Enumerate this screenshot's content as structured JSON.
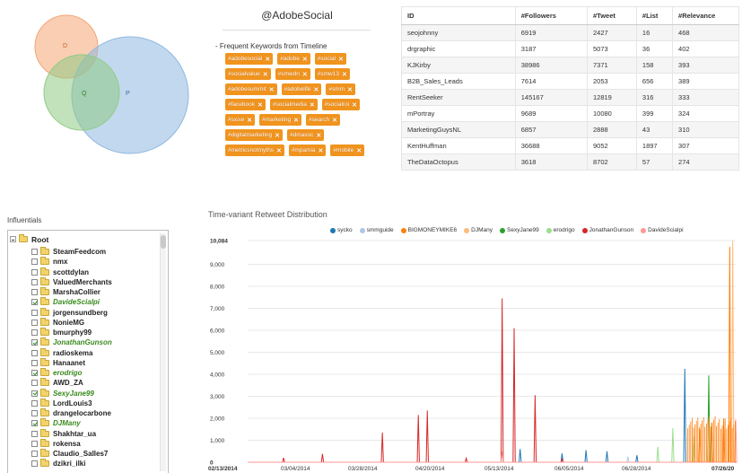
{
  "venn": {
    "sets": [
      {
        "label": "D",
        "color": "#f4a574"
      },
      {
        "label": "Q",
        "color": "#8fcb84"
      },
      {
        "label": "P",
        "color": "#8fb8e0"
      }
    ]
  },
  "account": {
    "title": "@AdobeSocial"
  },
  "keywords": {
    "heading": "- Frequent Keywords from Timeline",
    "remove_icon": "close-icon",
    "tag_color": "#f0941e",
    "items": [
      "#adobesocial",
      "#adobe",
      "#social",
      "#socialvalue",
      "#smwdn",
      "#smw13",
      "#adobesummit",
      "#adobelife",
      "#smm",
      "#facebook",
      "#socialmedia",
      "#socialroi",
      "#sxsw",
      "#marketing",
      "#search",
      "#digitalmarketing",
      "#dmasoc",
      "#metricsnotmyths",
      "#mpamia",
      "#mobile"
    ]
  },
  "table": {
    "headers": [
      "ID",
      "#Followers",
      "#Tweet",
      "#List",
      "#Relevance"
    ],
    "rows": [
      [
        "seojohnny",
        "6919",
        "2427",
        "16",
        "468"
      ],
      [
        "drgraphic",
        "3187",
        "5073",
        "36",
        "402"
      ],
      [
        "KJKirby",
        "38986",
        "7371",
        "158",
        "393"
      ],
      [
        "B2B_Sales_Leads",
        "7614",
        "2053",
        "656",
        "389"
      ],
      [
        "RentSeeker",
        "145167",
        "12819",
        "316",
        "333"
      ],
      [
        "mPortray",
        "9689",
        "10080",
        "399",
        "324"
      ],
      [
        "MarketingGuysNL",
        "6857",
        "2888",
        "43",
        "310"
      ],
      [
        "KentHuffman",
        "36688",
        "9052",
        "1897",
        "307"
      ],
      [
        "TheDataOctopus",
        "3618",
        "8702",
        "57",
        "274"
      ]
    ]
  },
  "influentials": {
    "label": "Influentials",
    "root": "Root",
    "items": [
      {
        "name": "SteamFeedcom",
        "checked": false
      },
      {
        "name": "nmx",
        "checked": false
      },
      {
        "name": "scottdylan",
        "checked": false
      },
      {
        "name": "ValuedMerchants",
        "checked": false
      },
      {
        "name": "MarshaCollier",
        "checked": false
      },
      {
        "name": "DavideScialpi",
        "checked": true
      },
      {
        "name": "jorgensundberg",
        "checked": false
      },
      {
        "name": "NonieMG",
        "checked": false
      },
      {
        "name": "bmurphy99",
        "checked": false
      },
      {
        "name": "JonathanGunson",
        "checked": true
      },
      {
        "name": "radioskema",
        "checked": false
      },
      {
        "name": "Hanaanet",
        "checked": false
      },
      {
        "name": "erodrigo",
        "checked": true
      },
      {
        "name": "AWD_ZA",
        "checked": false
      },
      {
        "name": "SexyJane99",
        "checked": true
      },
      {
        "name": "LordLouis3",
        "checked": false
      },
      {
        "name": "drangelocarbone",
        "checked": false
      },
      {
        "name": "DJMany",
        "checked": true
      },
      {
        "name": "Shakhtar_ua",
        "checked": false
      },
      {
        "name": "rokensa",
        "checked": false
      },
      {
        "name": "Claudio_Salles7",
        "checked": false
      },
      {
        "name": "dzikri_ilki",
        "checked": false
      }
    ]
  },
  "chart_title": "Time-variant Retweet Distribution",
  "chart_data": {
    "type": "line",
    "title": "Time-variant Retweet Distribution",
    "xlabel": "",
    "ylabel": "",
    "x_ticks": [
      "02/13/2014",
      "03/04/2014",
      "03/28/2014",
      "04/20/2014",
      "05/13/2014",
      "06/05/2014",
      "06/28/2014",
      "07/26/20"
    ],
    "x_range": [
      "2014-02-13",
      "2014-07-26"
    ],
    "ylim": [
      0,
      10084
    ],
    "y_ticks": [
      0,
      1000,
      2000,
      3000,
      4000,
      5000,
      6000,
      7000,
      8000,
      9000,
      10084
    ],
    "y_tick_labels": [
      "0",
      "1,000",
      "2,000",
      "3,000",
      "4,000",
      "5,000",
      "6,000",
      "7,000",
      "8,000",
      "9,000",
      "10,084"
    ],
    "grid": true,
    "legend_position": "top",
    "series": [
      {
        "name": "sycko",
        "color": "#1f77b4",
        "peaks": [
          [
            "2014-05-15",
            600
          ],
          [
            "2014-05-29",
            400
          ],
          [
            "2014-06-06",
            550
          ],
          [
            "2014-06-13",
            500
          ],
          [
            "2014-06-23",
            320
          ],
          [
            "2014-07-09",
            4250
          ]
        ]
      },
      {
        "name": "smmguide",
        "color": "#aec7e8",
        "peaks": [
          [
            "2014-06-20",
            250
          ]
        ]
      },
      {
        "name": "BIGMONEYMIKE6",
        "color": "#ff7f0e",
        "peaks": [
          [
            "2014-07-14",
            1500
          ],
          [
            "2014-07-18",
            1800
          ],
          [
            "2014-07-22",
            2000
          ],
          [
            "2014-07-24",
            9800
          ]
        ]
      },
      {
        "name": "DJMany",
        "color": "#ffbb78",
        "peaks": [
          [
            "2014-07-25",
            10084
          ]
        ]
      },
      {
        "name": "SexyJane99",
        "color": "#2ca02c",
        "peaks": [
          [
            "2014-07-17",
            3950
          ]
        ]
      },
      {
        "name": "erodrigo",
        "color": "#98df8a",
        "peaks": [
          [
            "2014-06-30",
            700
          ],
          [
            "2014-07-05",
            1550
          ],
          [
            "2014-07-12",
            1200
          ]
        ]
      },
      {
        "name": "JonathanGunson",
        "color": "#d62728",
        "peaks": [
          [
            "2014-02-25",
            200
          ],
          [
            "2014-03-10",
            380
          ],
          [
            "2014-03-30",
            1350
          ],
          [
            "2014-04-11",
            2150
          ],
          [
            "2014-04-14",
            2350
          ],
          [
            "2014-04-27",
            180
          ],
          [
            "2014-05-09",
            7450
          ],
          [
            "2014-05-13",
            6100
          ],
          [
            "2014-05-20",
            3050
          ],
          [
            "2014-05-29",
            150
          ]
        ]
      },
      {
        "name": "DavideScialpi",
        "color": "#ff9896",
        "peaks": [
          [
            "2014-05-09",
            500
          ],
          [
            "2014-07-26",
            1950
          ]
        ]
      }
    ]
  }
}
